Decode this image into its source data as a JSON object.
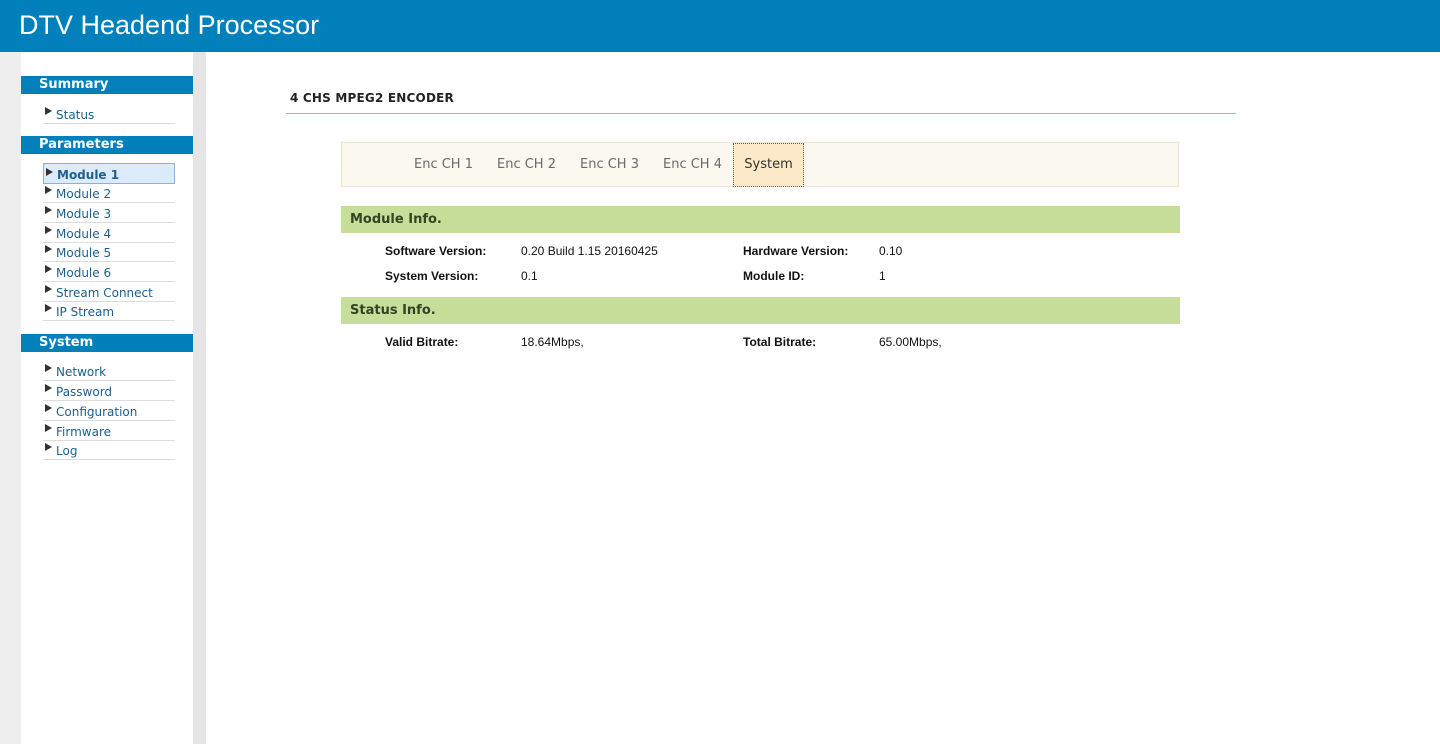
{
  "header": {
    "title": "DTV Headend Processor"
  },
  "sidebar": {
    "sections": [
      {
        "title": "Summary",
        "items": [
          "Status"
        ]
      },
      {
        "title": "Parameters",
        "items": [
          "Module 1",
          "Module 2",
          "Module 3",
          "Module 4",
          "Module 5",
          "Module 6",
          "Stream Connect",
          "IP Stream"
        ]
      },
      {
        "title": "System",
        "items": [
          "Network",
          "Password",
          "Configuration",
          "Firmware",
          "Log"
        ]
      }
    ],
    "active_item": "Module 1"
  },
  "main": {
    "page_title": "4 CHS MPEG2 ENCODER",
    "tabs": [
      "Enc CH 1",
      "Enc CH 2",
      "Enc CH 3",
      "Enc CH 4",
      "System"
    ],
    "active_tab": "System",
    "module_info": {
      "title": "Module Info.",
      "software_version_label": "Software Version:",
      "software_version": "0.20 Build 1.15 20160425",
      "hardware_version_label": "Hardware Version:",
      "hardware_version": "0.10",
      "system_version_label": "System Version:",
      "system_version": "0.1",
      "module_id_label": "Module ID:",
      "module_id": "1"
    },
    "status_info": {
      "title": "Status Info.",
      "valid_bitrate_label": "Valid Bitrate:",
      "valid_bitrate": "18.64Mbps,",
      "total_bitrate_label": "Total Bitrate:",
      "total_bitrate": "65.00Mbps,"
    }
  },
  "colors": {
    "header_blue": "#0280bc",
    "section_green": "#c7de9a",
    "tab_active_bg": "#fbe9c8"
  }
}
